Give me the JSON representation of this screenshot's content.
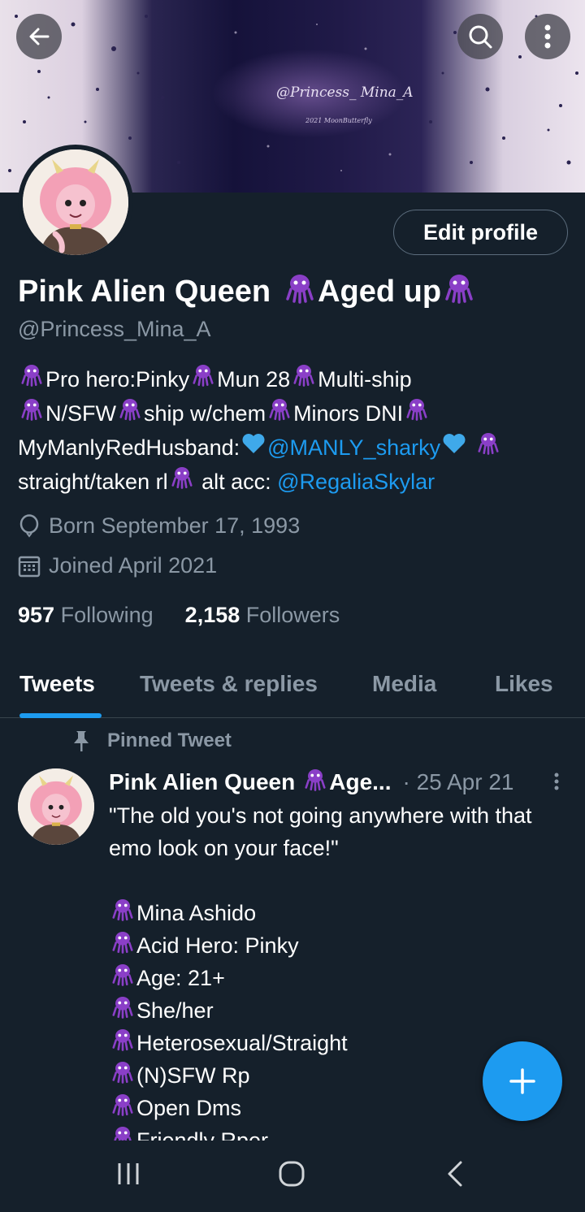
{
  "banner": {
    "signature": "@Princess_ Mina_A",
    "signature_small": "2021 MoonButterfly"
  },
  "header_icons": [
    "back-arrow-icon",
    "search-icon",
    "more-vertical-icon"
  ],
  "profile": {
    "edit_button": "Edit profile",
    "name_part1": "Pink Alien Queen",
    "name_part2": "Aged up",
    "handle": "@Princess_Mina_A",
    "bio": {
      "l1a": "Pro hero:Pinky",
      "l1b": "Mun 28",
      "l1c": "Multi-ship",
      "l2a": "N/SFW",
      "l2b": "ship w/chem",
      "l2c": "Minors DNI",
      "l3a": "MyManlyRedHusband: ",
      "l3_link": "@MANLY_sharky",
      "l4a": "straight/taken rl",
      "l4b": " alt acc: ",
      "l4_link": "@RegaliaSkylar"
    },
    "born": "Born September 17, 1993",
    "joined": "Joined April 2021",
    "following_count": "957",
    "following_label": "Following",
    "followers_count": "2,158",
    "followers_label": "Followers"
  },
  "tabs": [
    "Tweets",
    "Tweets & replies",
    "Media",
    "Likes"
  ],
  "active_tab": "Tweets",
  "pinned_tweet": {
    "pinned_label": "Pinned Tweet",
    "author": "Pink Alien Queen",
    "author_tail": "Age...",
    "date": "· 25 Apr 21",
    "text": "\"The old you's not going anywhere with that emo look on your face!\"",
    "list": [
      "Mina Ashido",
      "Acid Hero: Pinky",
      "Age: 21+",
      "She/her",
      "Heterosexual/Straight",
      "(N)SFW Rp",
      "Open Dms",
      "Friendly Rper"
    ]
  },
  "colors": {
    "background": "#15202b",
    "accent": "#1d9bf0",
    "secondary_text": "#8b98a5",
    "emoji_purple": "#8a3fc7"
  }
}
